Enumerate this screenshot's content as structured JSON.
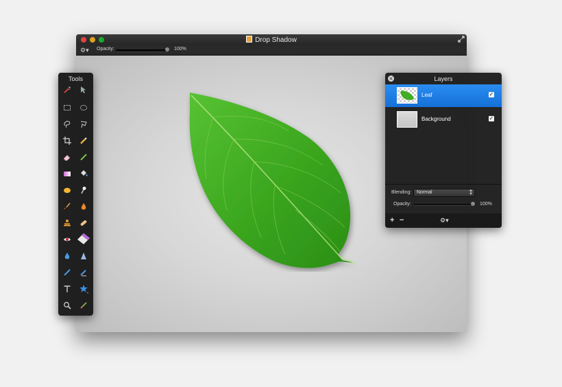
{
  "window": {
    "title": "Drop Shadow",
    "options_bar": {
      "opacity_label": "Opacity:",
      "opacity_value": "100%",
      "opacity_level": 1.0
    }
  },
  "tools_palette": {
    "title": "Tools",
    "tools": [
      "magic-wand-icon",
      "arrange-layers-icon",
      "rectangular-select-icon",
      "elliptical-select-icon",
      "lasso-icon",
      "polygonal-lasso-icon",
      "crop-icon",
      "color-picker-icon",
      "eraser-icon",
      "pencil-icon",
      "gradient-icon",
      "paint-bucket-icon",
      "sponge-icon",
      "smudge-icon",
      "brush-icon",
      "burn-icon",
      "stamp-icon",
      "bandage-icon",
      "red-eye-icon",
      "clean-eraser-icon",
      "blur-drop-icon",
      "sharpen-icon",
      "pen-icon",
      "freeform-pen-icon",
      "type-icon",
      "shape-star-icon",
      "zoom-icon",
      "color-brush-icon"
    ]
  },
  "layers_palette": {
    "title": "Layers",
    "layers": [
      {
        "name": "Leaf",
        "visible": true,
        "selected": true
      },
      {
        "name": "Background",
        "visible": true,
        "selected": false
      }
    ],
    "blending_label": "Blending:",
    "blending_value": "Normal",
    "opacity_label": "Opacity:",
    "opacity_value": "100%",
    "opacity_level": 1.0
  },
  "colors": {
    "selection_blue": "#1c7fe6",
    "leaf_green": "#3fae22",
    "window_dark": "#1c1c1c"
  }
}
